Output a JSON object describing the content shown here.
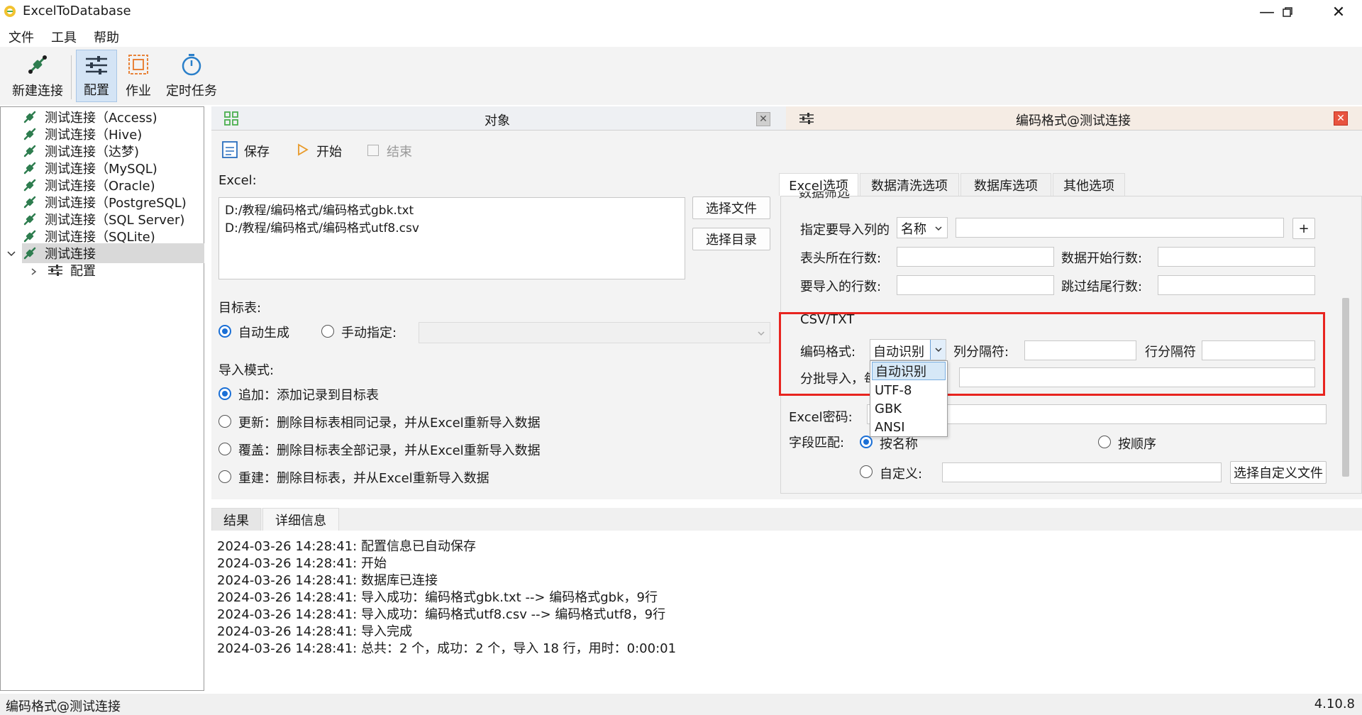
{
  "window": {
    "title": "ExcelToDatabase"
  },
  "menu": [
    "文件",
    "工具",
    "帮助"
  ],
  "toolbar": {
    "new_connection": "新建连接",
    "config": "配置",
    "job": "作业",
    "scheduled": "定时任务"
  },
  "tree": {
    "connections": [
      "测试连接（Access)",
      "测试连接（Hive)",
      "测试连接（达梦)",
      "测试连接（MySQL)",
      "测试连接（Oracle)",
      "测试连接（PostgreSQL)",
      "测试连接（SQL Server)",
      "测试连接（SQLite)"
    ],
    "selected": "测试连接",
    "child": "配置"
  },
  "object_panel": {
    "title": "对象",
    "save": "保存",
    "start": "开始",
    "end": "结束",
    "excel_label": "Excel:",
    "files": [
      "D:/教程/编码格式/编码格式gbk.txt",
      "D:/教程/编码格式/编码格式utf8.csv"
    ],
    "select_file": "选择文件",
    "select_dir": "选择目录",
    "target_label": "目标表:",
    "auto_gen": "自动生成",
    "manual": "手动指定:",
    "mode_label": "导入模式:",
    "modes": [
      "追加：添加记录到目标表",
      "更新：删除目标表相同记录，并从Excel重新导入数据",
      "覆盖：删除目标表全部记录，并从Excel重新导入数据",
      "重建：删除目标表，并从Excel重新导入数据"
    ]
  },
  "config_panel": {
    "title": "编码格式@测试连接",
    "tabs": [
      "Excel选项",
      "数据清洗选项",
      "数据库选项",
      "其他选项"
    ],
    "section_partial": "数据筛选",
    "import_col_label": "指定要导入列的",
    "import_col_value": "名称",
    "header_row_label": "表头所在行数:",
    "data_start_label": "数据开始行数:",
    "rows_label": "要导入的行数:",
    "skip_tail_label": "跳过结尾行数:",
    "csv_section": "CSV/TXT",
    "encoding_label": "编码格式:",
    "encoding_value": "自动识别",
    "col_sep_label": "列分隔符:",
    "row_sep_label": "行分隔符",
    "batch_label": "分批导入，每",
    "encoding_options": [
      "自动识别",
      "UTF-8",
      "GBK",
      "ANSI"
    ],
    "excel_pwd_label": "Excel密码:",
    "field_match_label": "字段匹配:",
    "by_name": "按名称",
    "by_order": "按顺序",
    "custom": "自定义:",
    "custom_btn": "选择自定义文件",
    "plus": "+"
  },
  "results": {
    "tabs": [
      "结果",
      "详细信息"
    ],
    "lines": [
      "2024-03-26 14:28:41:  配置信息已自动保存",
      "2024-03-26 14:28:41:  开始",
      "2024-03-26 14:28:41:  数据库已连接",
      "2024-03-26 14:28:41:  导入成功：编码格式gbk.txt --> 编码格式gbk，9行",
      "2024-03-26 14:28:41:  导入成功：编码格式utf8.csv --> 编码格式utf8，9行",
      "2024-03-26 14:28:41:  导入完成",
      "2024-03-26 14:28:41:  总共：2 个，成功：2 个，导入 18 行，用时：0:00:01"
    ]
  },
  "status": {
    "left": "编码格式@测试连接",
    "version": "4.10.8"
  },
  "colors": {
    "accent": "#1a6fd6",
    "highlight": "#e8241f",
    "tool_green": "#2e8b57"
  }
}
